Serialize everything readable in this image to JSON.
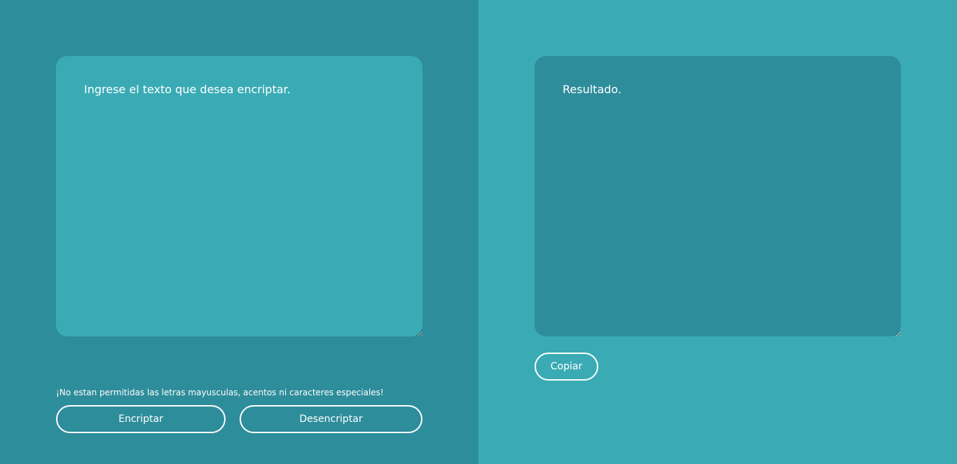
{
  "input": {
    "placeholder": "Ingrese el texto que desea encriptar.",
    "value": ""
  },
  "warning": {
    "text": "¡No estan permitidas las letras mayusculas, acentos ni caracteres especiales!"
  },
  "buttons": {
    "encrypt_label": "Encriptar",
    "decrypt_label": "Desencriptar",
    "copy_label": "Copiar"
  },
  "output": {
    "placeholder": "Resultado.",
    "value": ""
  },
  "colors": {
    "dark_teal": "#2e8d9b",
    "light_teal": "#3aabb5",
    "text": "#ffffff"
  }
}
